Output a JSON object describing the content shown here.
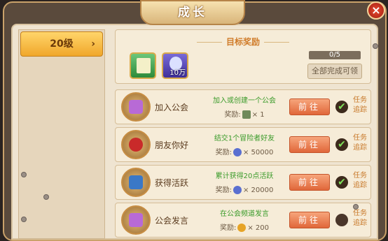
{
  "window": {
    "title": "成长",
    "close_label": "×"
  },
  "sidebar": {
    "level_label": "20级",
    "chevron": "›"
  },
  "target_reward": {
    "title": "目标奖励",
    "items": [
      {
        "icon": "green-card-icon",
        "count": ""
      },
      {
        "icon": "purple-crystal-icon",
        "count": "10万"
      }
    ],
    "progress": "0/5",
    "claim_all_label": "全部完成可领"
  },
  "tasks": [
    {
      "name": "加入公会",
      "desc": "加入或创建一个公会",
      "reward_prefix": "奖励:",
      "reward_icon": "guild-box-icon",
      "reward_amount": "× 1",
      "button": "前往",
      "tracked": true,
      "track_label": "任务追踪"
    },
    {
      "name": "朋友你好",
      "desc": "结交1个冒险者好友",
      "reward_prefix": "奖励:",
      "reward_icon": "crystal-icon",
      "reward_amount": "× 50000",
      "button": "前往",
      "tracked": true,
      "track_label": "任务追踪"
    },
    {
      "name": "获得活跃",
      "desc": "累计获得20点活跃",
      "reward_prefix": "奖励:",
      "reward_icon": "crystal-icon",
      "reward_amount": "× 20000",
      "button": "前往",
      "tracked": true,
      "track_label": "任务追踪"
    },
    {
      "name": "公会发言",
      "desc": "在公会频道发言",
      "reward_prefix": "奖励:",
      "reward_icon": "gold-medal-icon",
      "reward_amount": "× 200",
      "button": "前往",
      "tracked": false,
      "track_label": "任务追踪"
    }
  ],
  "colors": {
    "accent_orange": "#e0673a",
    "desc_green": "#3b9b2a",
    "tab_gold": "#f0a72b"
  }
}
